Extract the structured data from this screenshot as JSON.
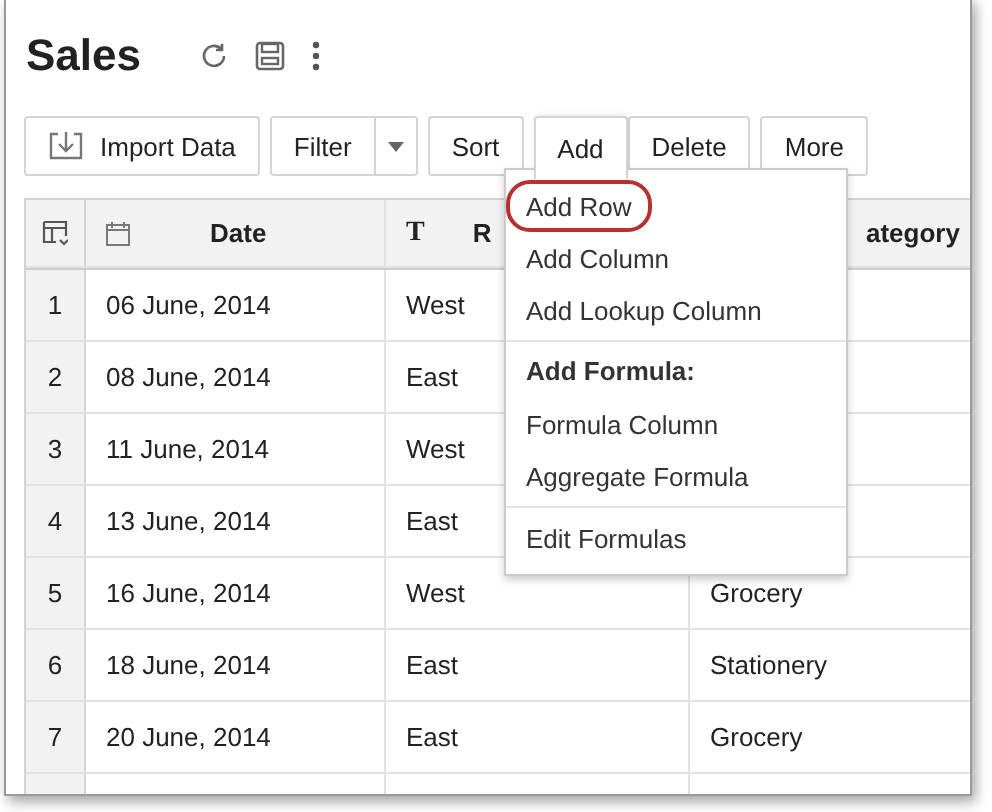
{
  "title": "Sales",
  "toolbar": [
    {
      "label": "Import Data",
      "kind": "import",
      "selected": false
    },
    {
      "label": "Filter",
      "kind": "split",
      "selected": false
    },
    {
      "label": "Sort",
      "kind": "plain",
      "selected": false
    },
    {
      "label": "Add",
      "kind": "plain",
      "selected": true
    },
    {
      "label": "Delete",
      "kind": "plain",
      "selected": false
    },
    {
      "label": "More",
      "kind": "plain",
      "selected": false
    }
  ],
  "table": {
    "columns": [
      {
        "label": "Date",
        "kind": "date"
      },
      {
        "label": "R",
        "kind": "text",
        "type_icon": "T"
      },
      {
        "label": "ategory",
        "kind": "none"
      }
    ],
    "rows": [
      {
        "index": "1",
        "cells": [
          "06 June, 2014",
          "West",
          ""
        ]
      },
      {
        "index": "2",
        "cells": [
          "08 June, 2014",
          "East",
          ""
        ]
      },
      {
        "index": "3",
        "cells": [
          "11 June, 2014",
          "West",
          ""
        ]
      },
      {
        "index": "4",
        "cells": [
          "13 June, 2014",
          "East",
          ""
        ]
      },
      {
        "index": "5",
        "cells": [
          "16 June, 2014",
          "West",
          "Grocery"
        ]
      },
      {
        "index": "6",
        "cells": [
          "18 June, 2014",
          "East",
          "Stationery"
        ]
      },
      {
        "index": "7",
        "cells": [
          "20 June, 2014",
          "East",
          "Grocery"
        ]
      }
    ]
  },
  "menu": {
    "groups": [
      {
        "items": [
          {
            "label": "Add Row",
            "circled": true
          },
          {
            "label": "Add Column",
            "circled": false
          },
          {
            "label": "Add Lookup Column",
            "circled": false
          }
        ]
      },
      {
        "heading": "Add Formula:",
        "items": [
          {
            "label": "Formula Column",
            "circled": false
          },
          {
            "label": "Aggregate Formula",
            "circled": false
          }
        ]
      },
      {
        "items": [
          {
            "label": "Edit Formulas",
            "circled": false
          }
        ]
      }
    ]
  }
}
